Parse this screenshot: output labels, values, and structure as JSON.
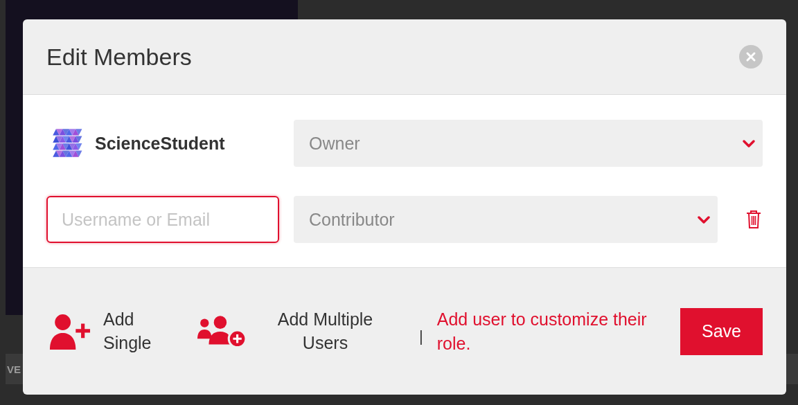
{
  "background": {
    "label": "VE"
  },
  "dialog": {
    "title": "Edit Members",
    "members": [
      {
        "kind": "existing",
        "name": "ScienceStudent",
        "role": "Owner"
      },
      {
        "kind": "new",
        "placeholder": "Username or Email",
        "role": "Contributor"
      }
    ],
    "actions": [
      {
        "kind": "single",
        "label": "Add Single"
      },
      {
        "kind": "multiple",
        "label": "Add Multiple Users"
      }
    ],
    "separator": "|",
    "hint": "Add user to customize their role.",
    "save": "Save"
  }
}
